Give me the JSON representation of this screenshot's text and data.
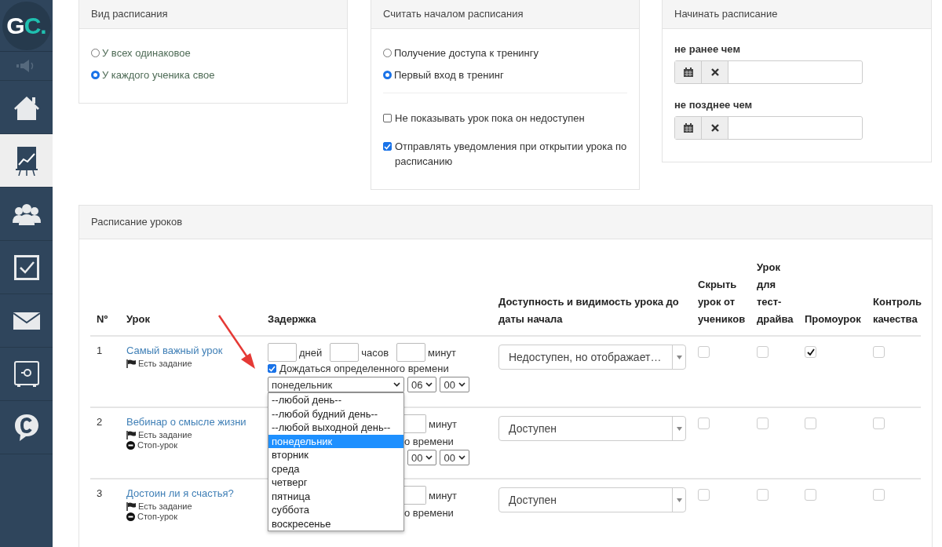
{
  "sidebar": {
    "logo": {
      "letters": "G",
      "accent": "C."
    },
    "items": [
      {
        "kind": "speaker",
        "selected": false
      },
      {
        "kind": "home",
        "selected": false
      },
      {
        "kind": "chart",
        "selected": true
      },
      {
        "kind": "people",
        "selected": false
      },
      {
        "kind": "check",
        "selected": false
      },
      {
        "kind": "mail",
        "selected": false
      },
      {
        "kind": "safe",
        "selected": false
      },
      {
        "kind": "chat",
        "selected": false
      }
    ]
  },
  "schedule_type": {
    "title": "Вид расписания",
    "options": [
      {
        "label": "У всех одинаковое",
        "selected": false
      },
      {
        "label": "У каждого ученика свое",
        "selected": true
      }
    ]
  },
  "schedule_start": {
    "title": "Считать началом расписания",
    "options": [
      {
        "label": "Получение доступа к тренингу",
        "selected": false
      },
      {
        "label": "Первый вход в тренинг",
        "selected": true
      }
    ],
    "checkboxes": [
      {
        "label": "Не показывать урок пока он недоступен",
        "checked": false
      },
      {
        "label": "Отправлять уведомления при открытии урока по расписанию",
        "checked": true
      }
    ]
  },
  "start_window": {
    "title": "Начинать расписание",
    "fields": [
      {
        "label": "не ранее чем"
      },
      {
        "label": "не позднее чем"
      }
    ]
  },
  "lessons": {
    "title": "Расписание уроков",
    "columns": [
      "Nº",
      "Урок",
      "Задержка",
      "Доступность и видимость урока до даты начала",
      "Скрыть урок от учеников",
      "Урок для тест-драйва",
      "Промоурок",
      "Контроль качества"
    ],
    "rows": [
      {
        "number": "1",
        "title": "Самый важный урок",
        "tags": [
          {
            "kind": "task",
            "label": "Есть задание"
          }
        ],
        "delay": {
          "kind": "full",
          "days_label": "дней",
          "hours_label": "часов",
          "minutes_label": "минут",
          "wait": {
            "label": "Дождаться определенного времени",
            "checked": true
          },
          "day": "понедельник",
          "hour": "06",
          "minute": "00"
        },
        "availability": "Недоступен, но отображает…",
        "hidden": false,
        "test_drive": false,
        "promo": true,
        "quality": false
      },
      {
        "number": "2",
        "title": "Вебинар о смысле жизни",
        "tags": [
          {
            "kind": "task",
            "label": "Есть задание"
          },
          {
            "kind": "stop",
            "label": "Стоп-урок"
          }
        ],
        "delay": {
          "kind": "covered",
          "minutes_label": "минут",
          "wait_label": "о времени",
          "hour": "00",
          "minute": "00"
        },
        "availability": "Доступен",
        "hidden": false,
        "test_drive": false,
        "promo": false,
        "quality": false
      },
      {
        "number": "3",
        "title": "Достоин ли я счастья?",
        "tags": [
          {
            "kind": "task",
            "label": "Есть задание"
          },
          {
            "kind": "stop",
            "label": "Стоп-урок"
          }
        ],
        "delay": {
          "kind": "covered",
          "minutes_label": "минут",
          "wait_label": "о времени"
        },
        "availability": "Доступен",
        "hidden": false,
        "test_drive": false,
        "promo": false,
        "quality": false
      }
    ],
    "day_dropdown": {
      "options": [
        {
          "label": "--любой день--",
          "selected": false
        },
        {
          "label": "--любой будний день--",
          "selected": false
        },
        {
          "label": "--любой выходной день--",
          "selected": false
        },
        {
          "label": "понедельник",
          "selected": true
        },
        {
          "label": "вторник",
          "selected": false
        },
        {
          "label": "среда",
          "selected": false
        },
        {
          "label": "четверг",
          "selected": false
        },
        {
          "label": "пятница",
          "selected": false
        },
        {
          "label": "суббота",
          "selected": false
        },
        {
          "label": "воскресенье",
          "selected": false
        }
      ]
    }
  }
}
